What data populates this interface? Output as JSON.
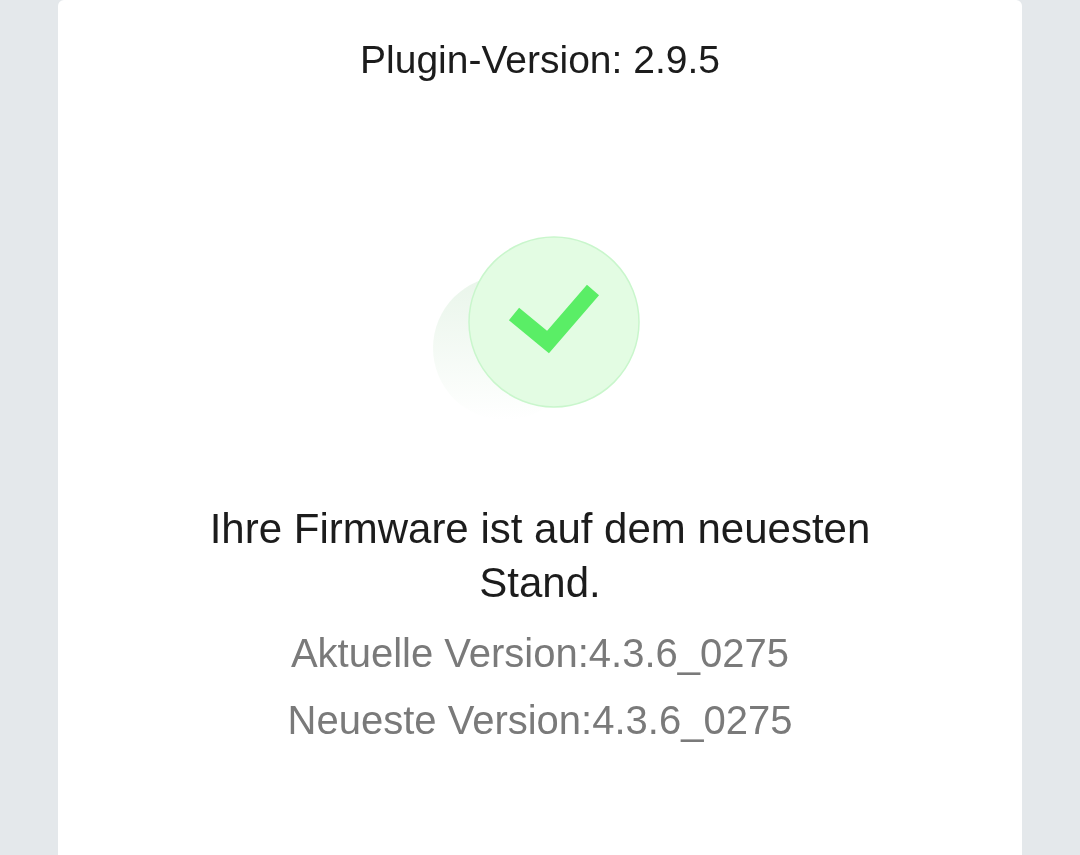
{
  "plugin_version": "Plugin-Version: 2.9.5",
  "status": {
    "title": "Ihre Firmware ist auf dem neuesten Stand."
  },
  "versions": [
    {
      "text": "Aktuelle Version:4.3.6_0275"
    },
    {
      "text": "Neueste Version:4.3.6_0275"
    }
  ]
}
